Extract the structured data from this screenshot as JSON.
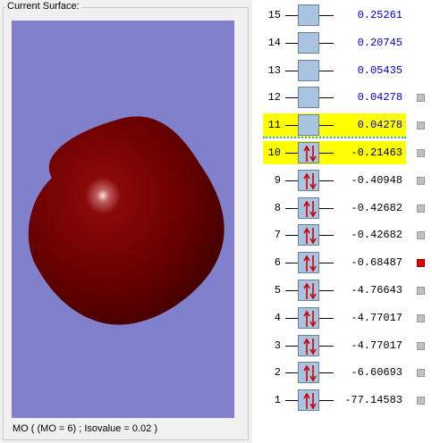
{
  "surface_group": {
    "title": "Current Surface:",
    "status": "MO ( (MO = 6) ; Isovalue = 0.02 )",
    "background_color": "#8080cc",
    "surface_color": "#7a0000"
  },
  "mo_list": [
    {
      "num": "15",
      "energy": "0.25261",
      "occupied": false,
      "highlight": false,
      "square": "none"
    },
    {
      "num": "14",
      "energy": "0.20745",
      "occupied": false,
      "highlight": false,
      "square": "none"
    },
    {
      "num": "13",
      "energy": "0.05435",
      "occupied": false,
      "highlight": false,
      "square": "none"
    },
    {
      "num": "12",
      "energy": "0.04278",
      "occupied": false,
      "highlight": false,
      "square": "gray"
    },
    {
      "num": "11",
      "energy": "0.04278",
      "occupied": false,
      "highlight": true,
      "square": "gray"
    },
    {
      "num": "10",
      "energy": "-0.21463",
      "occupied": true,
      "highlight": true,
      "square": "gray"
    },
    {
      "num": "9",
      "energy": "-0.40948",
      "occupied": true,
      "highlight": false,
      "square": "gray"
    },
    {
      "num": "8",
      "energy": "-0.42682",
      "occupied": true,
      "highlight": false,
      "square": "gray"
    },
    {
      "num": "7",
      "energy": "-0.42682",
      "occupied": true,
      "highlight": false,
      "square": "gray"
    },
    {
      "num": "6",
      "energy": "-0.68487",
      "occupied": true,
      "highlight": false,
      "square": "red"
    },
    {
      "num": "5",
      "energy": "-4.76643",
      "occupied": true,
      "highlight": false,
      "square": "gray"
    },
    {
      "num": "4",
      "energy": "-4.77017",
      "occupied": true,
      "highlight": false,
      "square": "gray"
    },
    {
      "num": "3",
      "energy": "-4.77017",
      "occupied": true,
      "highlight": false,
      "square": "gray"
    },
    {
      "num": "2",
      "energy": "-6.60693",
      "occupied": true,
      "highlight": false,
      "square": "gray"
    },
    {
      "num": "1",
      "energy": "-77.14583",
      "occupied": true,
      "highlight": false,
      "square": "gray"
    }
  ],
  "colors": {
    "highlight": "#ffff00",
    "positive_energy": "#0000cc",
    "selected_square": "#e00000",
    "electron_arrow": "#cc0000",
    "orbital_box": "#a8c4e0"
  }
}
